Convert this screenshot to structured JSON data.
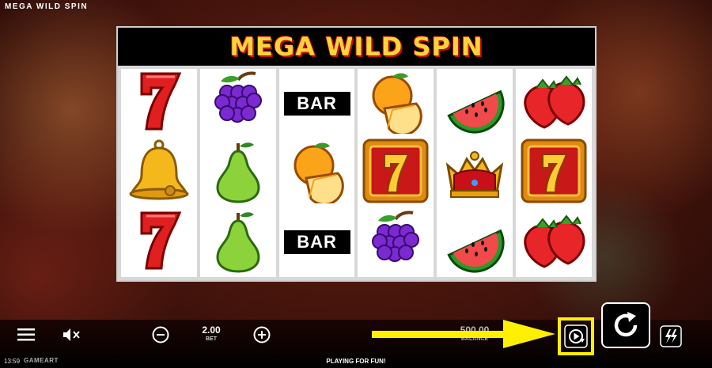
{
  "game": {
    "title": "MEGA WILD SPIN",
    "banner_title": "MEGA WILD SPIN"
  },
  "reels": [
    [
      "seven",
      "bell",
      "seven"
    ],
    [
      "grapes",
      "pear",
      "pear"
    ],
    [
      "bar",
      "orange",
      "bar"
    ],
    [
      "orange",
      "seven_framed",
      "grapes"
    ],
    [
      "watermelon",
      "crown",
      "watermelon"
    ],
    [
      "strawberries",
      "seven_framed",
      "strawberries"
    ]
  ],
  "symbols": {
    "bar_label": "BAR",
    "seven_label": "7"
  },
  "controls": {
    "bet_value": "2.00",
    "bet_label": "BET",
    "balance_value": "500.00",
    "balance_label": "BALANCE"
  },
  "status": {
    "clock": "13:59",
    "provider": "GAMEART",
    "message": "PLAYING FOR FUN!"
  },
  "colors": {
    "highlight": "#ffef00",
    "title_text": "#ffd33a",
    "title_outline": "#c41010"
  }
}
